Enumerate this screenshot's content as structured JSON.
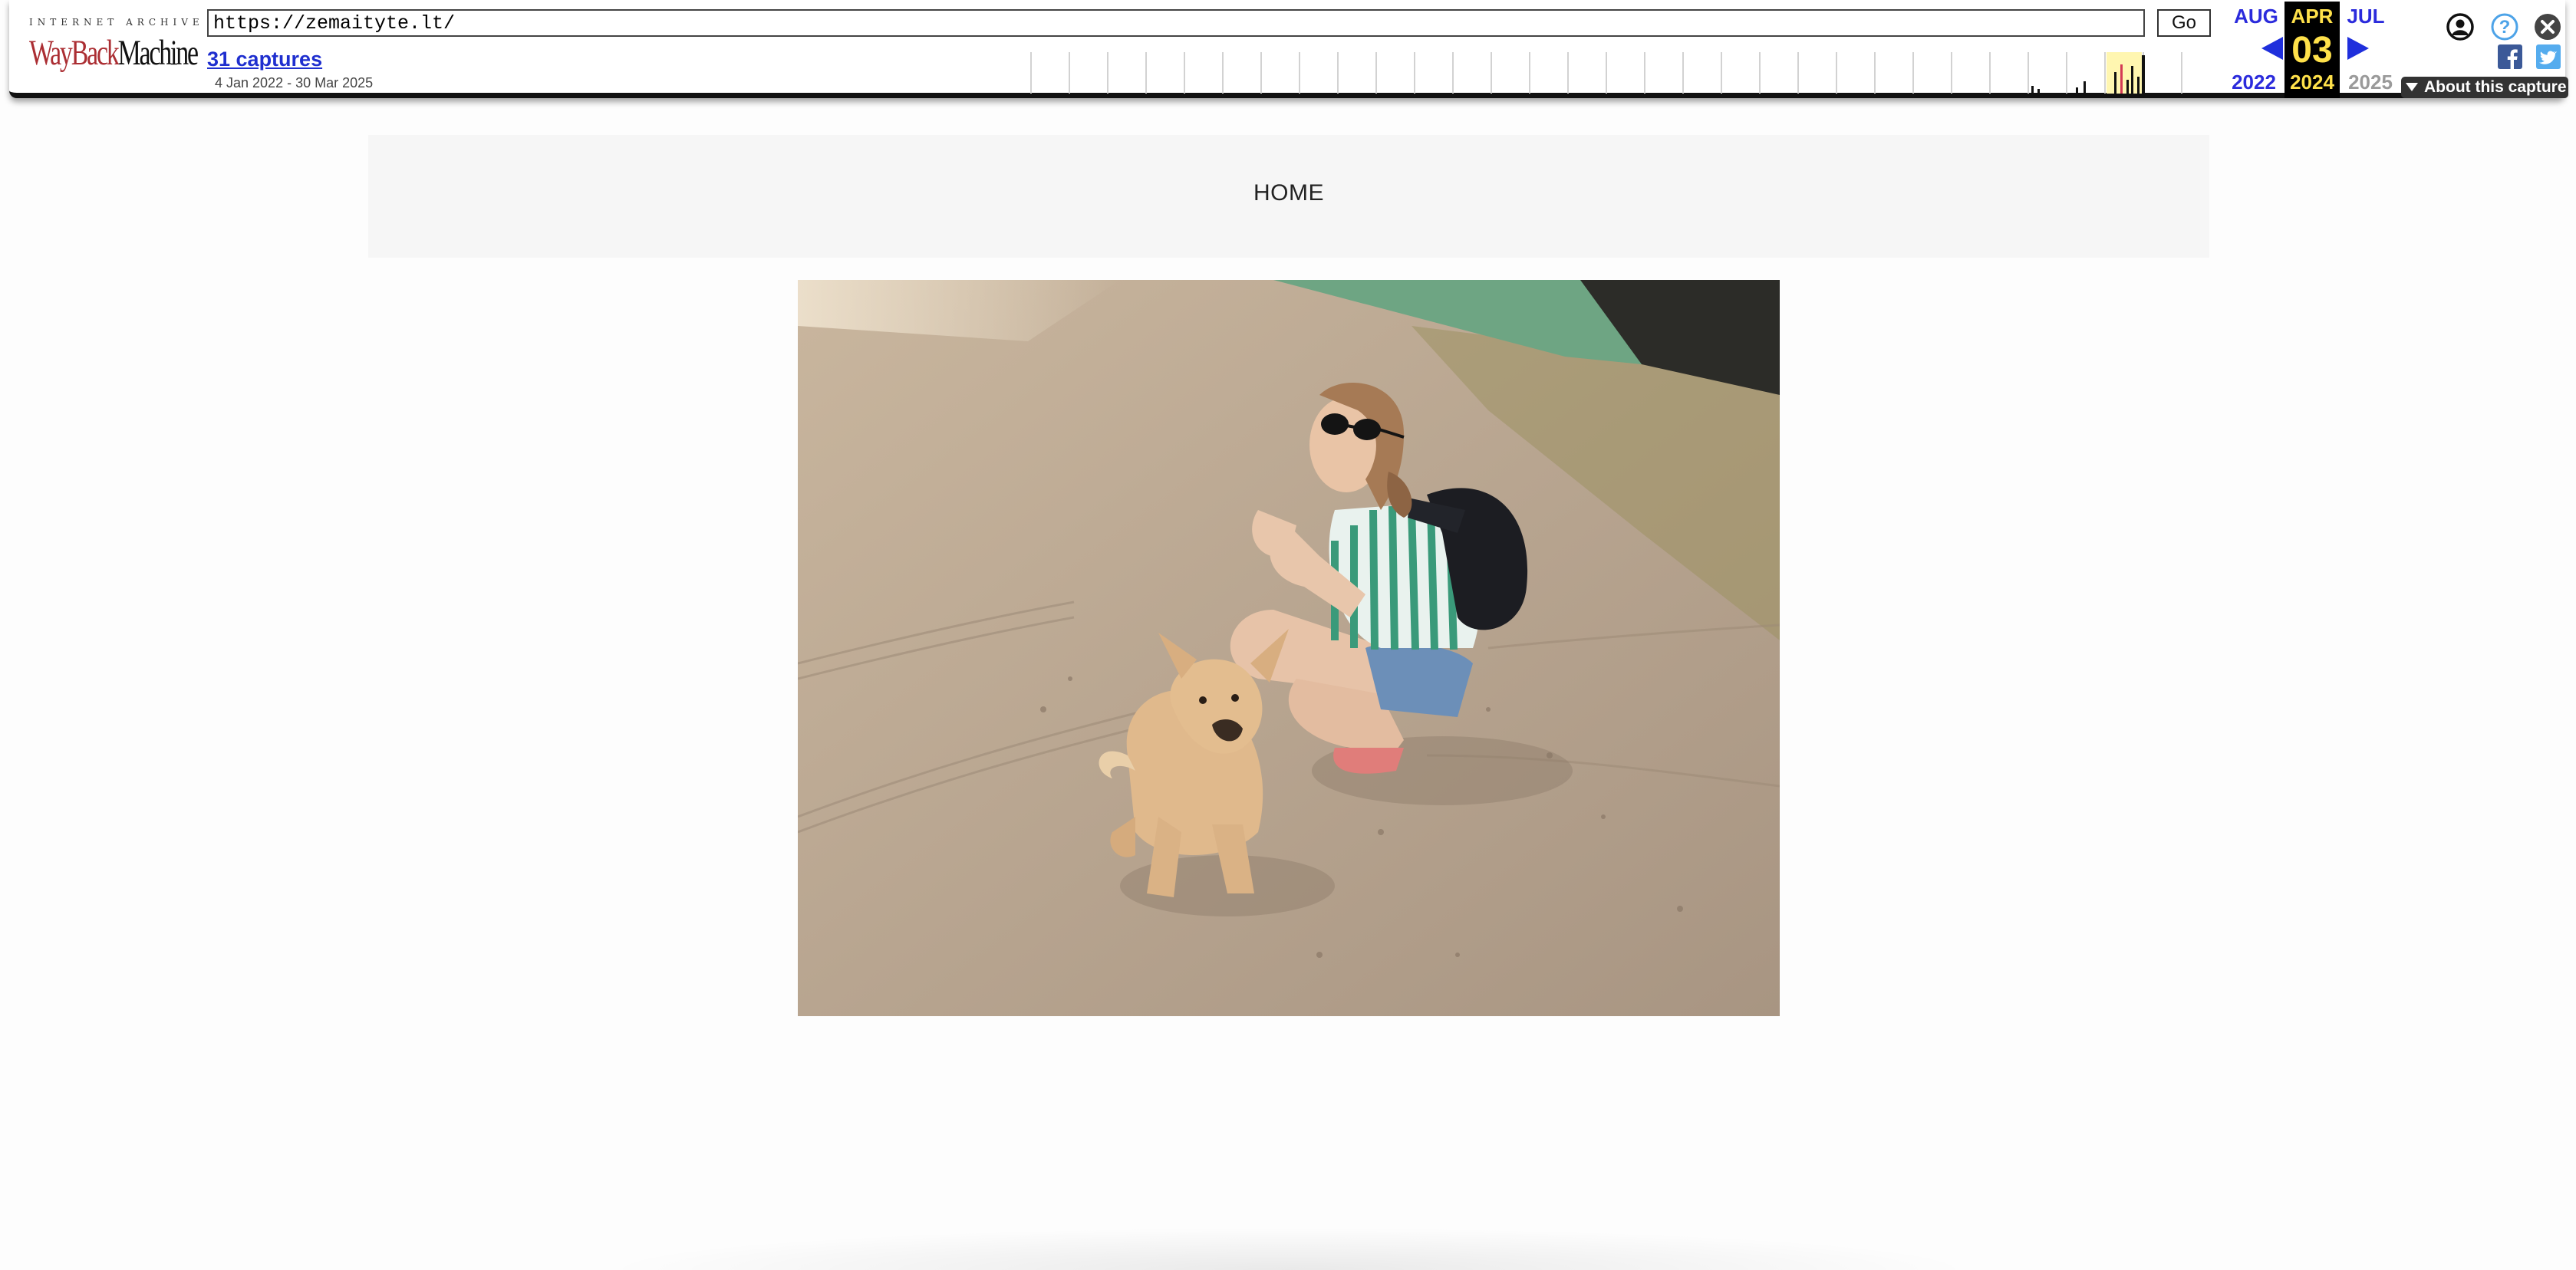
{
  "wayback": {
    "logo_top": "INTERNET ARCHIVE",
    "logo_way": "WayBack",
    "logo_machine": "Machine",
    "url": "https://zemaityte.lt/",
    "go_label": "Go",
    "captures_label": "31 captures",
    "date_range": "4 Jan 2022 - 30 Mar 2025",
    "prev_month": "AUG",
    "current_month": "APR",
    "next_month": "JUL",
    "prev_year": "2022",
    "current_day": "03",
    "current_year": "2024",
    "next_year": "2025",
    "about_label": "About this capture",
    "accent_color": "#1f2fdc",
    "highlight_color": "#ffe14a"
  },
  "site": {
    "nav_home": "HOME",
    "hero_alt": "Woman in sunglasses with backpack crouching next to a small tan dog on a dirt road"
  }
}
